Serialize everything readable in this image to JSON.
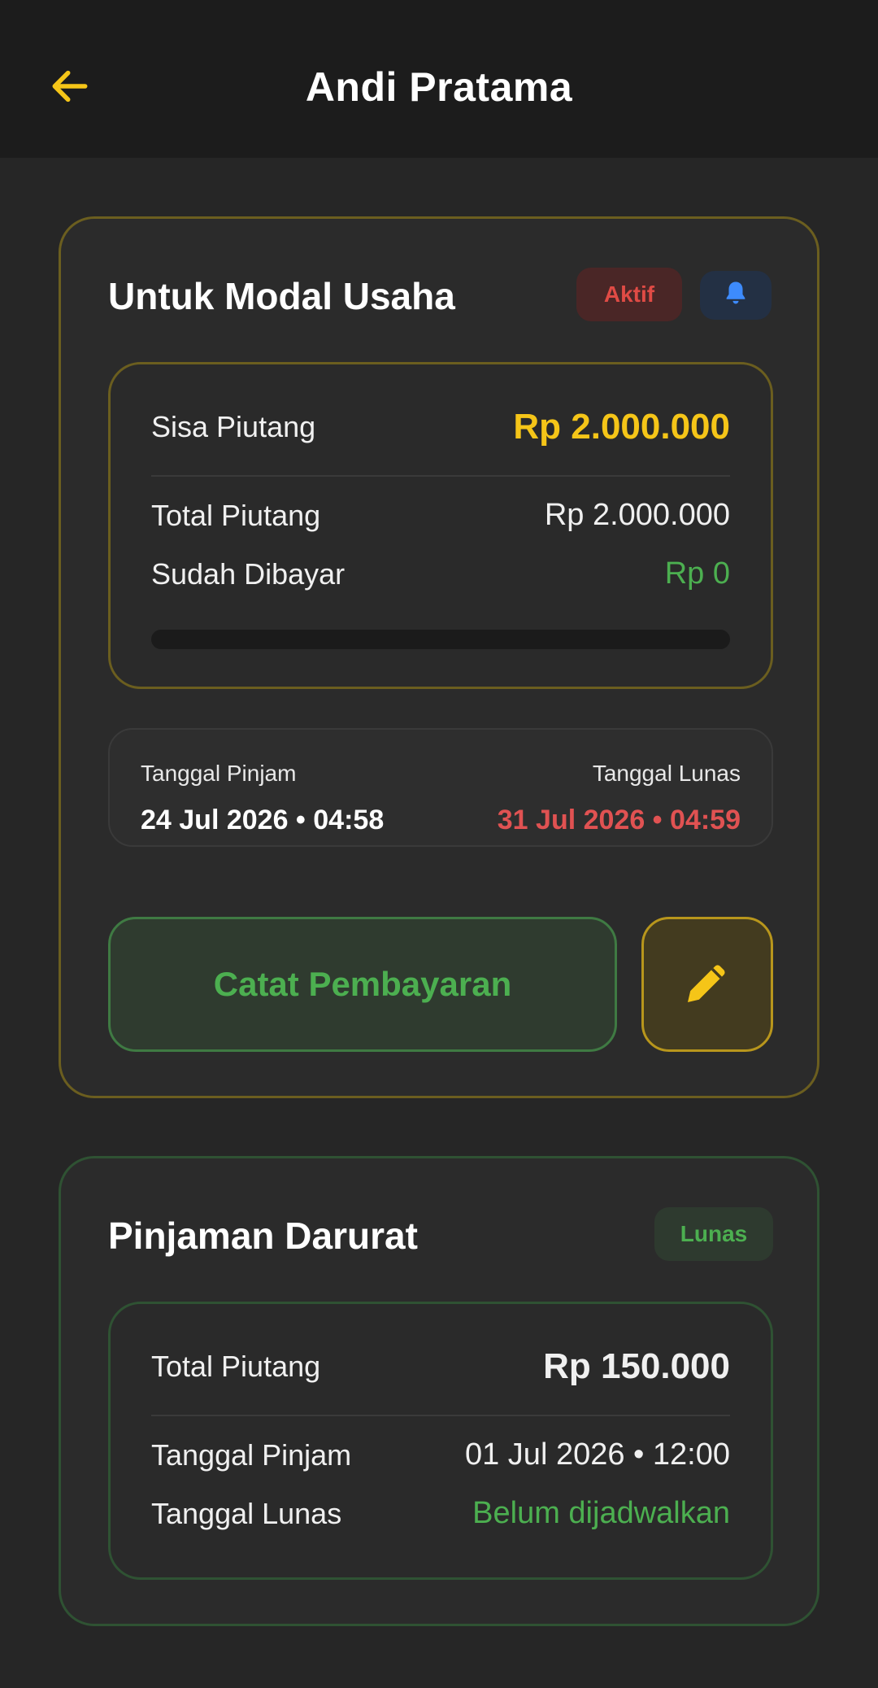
{
  "header": {
    "title": "Andi Pratama"
  },
  "active_loan": {
    "title": "Untuk Modal Usaha",
    "status": "Aktif",
    "summary": {
      "remaining_label": "Sisa Piutang",
      "remaining_value": "Rp 2.000.000",
      "total_label": "Total Piutang",
      "total_value": "Rp 2.000.000",
      "paid_label": "Sudah Dibayar",
      "paid_value": "Rp 0",
      "paid_fraction": 0
    },
    "dates": {
      "borrow_label": "Tanggal Pinjam",
      "borrow_value": "24 Jul 2026 • 04:58",
      "due_label": "Tanggal Lunas",
      "due_value": "31 Jul 2026 • 04:59"
    },
    "pay_button": "Catat Pembayaran"
  },
  "paid_loan": {
    "title": "Pinjaman Darurat",
    "status": "Lunas",
    "total_label": "Total Piutang",
    "total_value": "Rp 150.000",
    "borrow_label": "Tanggal Pinjam",
    "borrow_value": "01 Jul 2026 • 12:00",
    "due_label": "Tanggal Lunas",
    "due_value": "Belum dijadwalkan"
  },
  "icons": {
    "back": "arrow-left-icon",
    "bell": "bell-icon",
    "edit": "pencil-icon"
  },
  "colors": {
    "accent_yellow": "#f5c518",
    "green": "#4caf50",
    "red": "#e05252",
    "blue": "#3d8bfd"
  }
}
